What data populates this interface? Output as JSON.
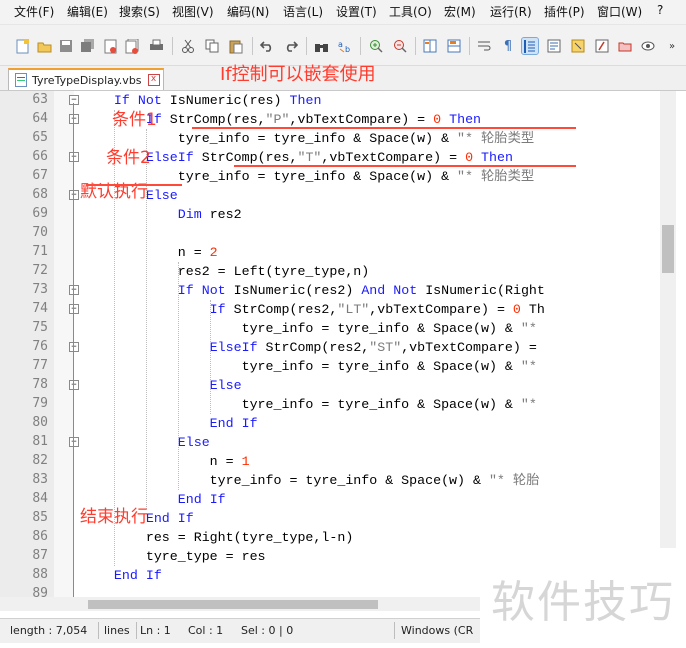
{
  "menu": [
    "文件(F)",
    "编辑(E)",
    "搜索(S)",
    "视图(V)",
    "编码(N)",
    "语言(L)",
    "设置(T)",
    "工具(O)",
    "宏(M)",
    "运行(R)",
    "插件(P)",
    "窗口(W)",
    "?"
  ],
  "tab": {
    "filename": "TyreTypeDisplay.vbs"
  },
  "annotations": {
    "nesting": "If控制可以嵌套使用",
    "condition1": "条件1",
    "condition2": "条件2",
    "default": "默认执行",
    "end": "结束执行"
  },
  "code_lines": [
    {
      "n": "63",
      "text": "    If Not IsNumeric(res) Then"
    },
    {
      "n": "64",
      "text": "        If StrComp(res,\"P\",vbTextCompare) = 0 Then"
    },
    {
      "n": "65",
      "text": "            tyre_info = tyre_info & Space(w) & \"* 轮胎类型"
    },
    {
      "n": "66",
      "text": "        ElseIf StrComp(res,\"T\",vbTextCompare) = 0 Then"
    },
    {
      "n": "67",
      "text": "            tyre_info = tyre_info & Space(w) & \"* 轮胎类型"
    },
    {
      "n": "68",
      "text": "        Else"
    },
    {
      "n": "69",
      "text": "            Dim res2"
    },
    {
      "n": "70",
      "text": ""
    },
    {
      "n": "71",
      "text": "            n = 2"
    },
    {
      "n": "72",
      "text": "            res2 = Left(tyre_type,n)"
    },
    {
      "n": "73",
      "text": "            If Not IsNumeric(res2) And Not IsNumeric(Right"
    },
    {
      "n": "74",
      "text": "                If StrComp(res2,\"LT\",vbTextCompare) = 0 Th"
    },
    {
      "n": "75",
      "text": "                    tyre_info = tyre_info & Space(w) & \"*"
    },
    {
      "n": "76",
      "text": "                ElseIf StrComp(res2,\"ST\",vbTextCompare) ="
    },
    {
      "n": "77",
      "text": "                    tyre_info = tyre_info & Space(w) & \"*"
    },
    {
      "n": "78",
      "text": "                Else"
    },
    {
      "n": "79",
      "text": "                    tyre_info = tyre_info & Space(w) & \"*"
    },
    {
      "n": "80",
      "text": "                End If"
    },
    {
      "n": "81",
      "text": "            Else"
    },
    {
      "n": "82",
      "text": "                n = 1"
    },
    {
      "n": "83",
      "text": "                tyre_info = tyre_info & Space(w) & \"* 轮胎"
    },
    {
      "n": "84",
      "text": "            End If"
    },
    {
      "n": "85",
      "text": "        End If"
    },
    {
      "n": "86",
      "text": "        res = Right(tyre_type,l-n)"
    },
    {
      "n": "87",
      "text": "        tyre_type = res"
    },
    {
      "n": "88",
      "text": "    End If"
    },
    {
      "n": "89",
      "text": ""
    }
  ],
  "status": {
    "length": "length : 7,054",
    "lines": "lines",
    "ln": "Ln : 1",
    "col": "Col : 1",
    "sel": "Sel : 0 | 0",
    "eol": "Windows (CR"
  },
  "watermark": "软件技巧",
  "colors": {
    "keyword": "#1a1aff",
    "string": "#7b7b7b",
    "number": "#ff2b00",
    "annotation": "#ff3c2e"
  }
}
